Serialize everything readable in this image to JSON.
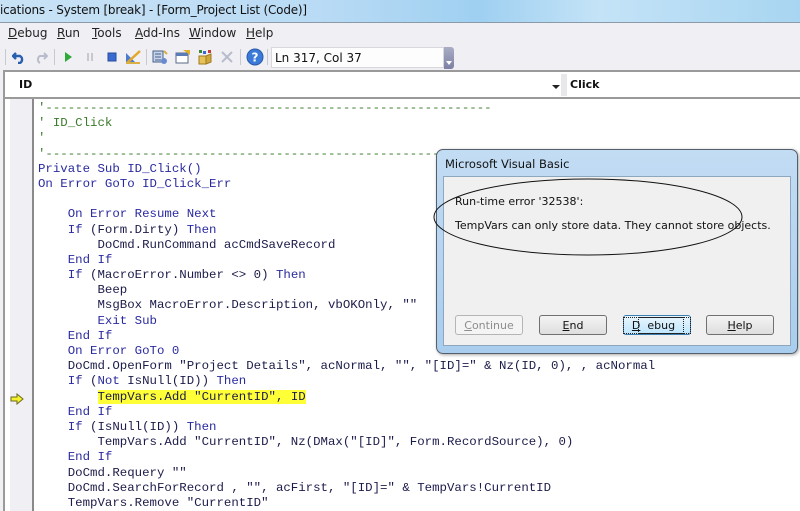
{
  "window": {
    "title": "ications - System [break] - [Form_Project List (Code)]"
  },
  "menu": [
    {
      "label": "Debug",
      "accel": "D",
      "rest": "ebug"
    },
    {
      "label": "Run",
      "accel": "R",
      "rest": "un"
    },
    {
      "label": "Tools",
      "accel": "T",
      "rest": "ools"
    },
    {
      "label": "Add-Ins",
      "accel": "A",
      "rest": "dd-Ins"
    },
    {
      "label": "Window",
      "accel": "W",
      "rest": "indow"
    },
    {
      "label": "Help",
      "accel": "H",
      "rest": "elp"
    }
  ],
  "toolbar": {
    "icons": [
      "undo-icon",
      "redo-icon",
      "run-icon",
      "break-icon",
      "reset-icon",
      "design-mode-icon",
      "project-explorer-icon",
      "properties-window-icon",
      "object-browser-icon",
      "toolbox-icon",
      "help-icon"
    ],
    "position_readout": "Ln 317, Col 37"
  },
  "code_window": {
    "object_combo": "ID",
    "procedure_combo": "Click",
    "current_line_index": 19,
    "lines": [
      [
        {
          "t": "'------------------------------------------------------------",
          "c": "cm"
        }
      ],
      [
        {
          "t": "' ID_Click",
          "c": "cm"
        }
      ],
      [
        {
          "t": "'",
          "c": "cm"
        }
      ],
      [
        {
          "t": "'------------------------------------------------------------",
          "c": "cm"
        }
      ],
      [
        {
          "t": "Private Sub ID_Click()",
          "c": "kw"
        }
      ],
      [
        {
          "t": "On Error GoTo ID_Click_Err",
          "c": "kw"
        }
      ],
      [
        {
          "t": "",
          "c": ""
        }
      ],
      [
        {
          "t": "    On Error Resume Next",
          "c": "kw"
        }
      ],
      [
        {
          "t": "    If",
          "c": "kw"
        },
        {
          "t": " (Form.Dirty) ",
          "c": ""
        },
        {
          "t": "Then",
          "c": "kw"
        }
      ],
      [
        {
          "t": "        DoCmd.RunCommand acCmdSaveRecord",
          "c": ""
        }
      ],
      [
        {
          "t": "    End If",
          "c": "kw"
        }
      ],
      [
        {
          "t": "    If",
          "c": "kw"
        },
        {
          "t": " (MacroError.Number <> 0) ",
          "c": ""
        },
        {
          "t": "Then",
          "c": "kw"
        }
      ],
      [
        {
          "t": "        Beep",
          "c": ""
        }
      ],
      [
        {
          "t": "        MsgBox MacroError.Description, vbOKOnly, \"\"",
          "c": ""
        }
      ],
      [
        {
          "t": "        Exit Sub",
          "c": "kw"
        }
      ],
      [
        {
          "t": "    End If",
          "c": "kw"
        }
      ],
      [
        {
          "t": "    On Error GoTo 0",
          "c": "kw"
        }
      ],
      [
        {
          "t": "    DoCmd.OpenForm \"Project Details\", acNormal, \"\", \"[ID]=\" & Nz(ID, 0), , acNormal",
          "c": ""
        }
      ],
      [
        {
          "t": "    If",
          "c": "kw"
        },
        {
          "t": " (",
          "c": ""
        },
        {
          "t": "Not",
          "c": "kw"
        },
        {
          "t": " IsNull(ID)) ",
          "c": ""
        },
        {
          "t": "Then",
          "c": "kw"
        }
      ],
      [
        {
          "t": "        ",
          "c": ""
        },
        {
          "t": "TempVars.Add \"CurrentID\", ID",
          "c": "hl"
        }
      ],
      [
        {
          "t": "    End If",
          "c": "kw"
        }
      ],
      [
        {
          "t": "    If",
          "c": "kw"
        },
        {
          "t": " (IsNull(ID)) ",
          "c": ""
        },
        {
          "t": "Then",
          "c": "kw"
        }
      ],
      [
        {
          "t": "        TempVars.Add \"CurrentID\", Nz(DMax(\"[ID]\", Form.RecordSource), 0)",
          "c": ""
        }
      ],
      [
        {
          "t": "    End If",
          "c": "kw"
        }
      ],
      [
        {
          "t": "    DoCmd.Requery \"\"",
          "c": ""
        }
      ],
      [
        {
          "t": "    DoCmd.SearchForRecord , \"\", acFirst, \"[ID]=\" & TempVars!CurrentID",
          "c": ""
        }
      ],
      [
        {
          "t": "    TempVars.Remove \"CurrentID\"",
          "c": ""
        }
      ]
    ]
  },
  "dialog": {
    "title": "Microsoft Visual Basic",
    "error_line": "Run-time error '32538':",
    "message": "TempVars can only store data. They cannot store objects.",
    "buttons": [
      {
        "label": "Continue",
        "accel": "C",
        "rest": "ontinue",
        "enabled": false,
        "default": false
      },
      {
        "label": "End",
        "accel": "E",
        "rest": "nd",
        "enabled": true,
        "default": false
      },
      {
        "label": "Debug",
        "accel": "D",
        "rest": "ebug",
        "enabled": true,
        "default": true
      },
      {
        "label": "Help",
        "accel": "H",
        "rest": "elp",
        "enabled": true,
        "default": false
      }
    ]
  },
  "colors": {
    "comment": "#3a7a2a",
    "keyword": "#2a2aa0",
    "text": "#1b1b4a",
    "highlight": "#ffff38",
    "exec_arrow": "#f6f22a"
  }
}
